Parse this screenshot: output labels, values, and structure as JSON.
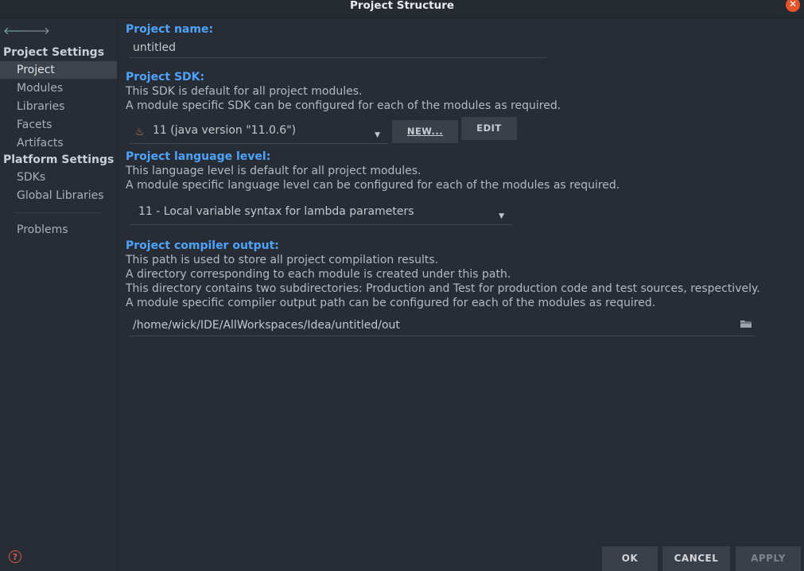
{
  "window": {
    "title": "Project Structure"
  },
  "sidebar": {
    "project_settings_label": "Project Settings",
    "project_items": [
      {
        "label": "Project",
        "selected": true
      },
      {
        "label": "Modules"
      },
      {
        "label": "Libraries"
      },
      {
        "label": "Facets"
      },
      {
        "label": "Artifacts"
      }
    ],
    "platform_settings_label": "Platform Settings",
    "platform_items": [
      {
        "label": "SDKs"
      },
      {
        "label": "Global Libraries"
      }
    ],
    "problems_label": "Problems"
  },
  "main": {
    "project_name": {
      "heading": "Project name:",
      "value": "untitled"
    },
    "project_sdk": {
      "heading": "Project SDK:",
      "line1": "This SDK is default for all project modules.",
      "line2": "A module specific SDK can be configured for each of the modules as required.",
      "selected": "11 (java version \"11.0.6\")",
      "new_button": "NEW...",
      "edit_button": "EDIT"
    },
    "language_level": {
      "heading": "Project language level:",
      "line1": "This language level is default for all project modules.",
      "line2": "A module specific language level can be configured for each of the modules as required.",
      "selected": "11 - Local variable syntax for lambda parameters"
    },
    "compiler_output": {
      "heading": "Project compiler output:",
      "line1": "This path is used to store all project compilation results.",
      "line2": "A directory corresponding to each module is created under this path.",
      "line3": "This directory contains two subdirectories: Production and Test for production code and test sources, respectively.",
      "line4": "A module specific compiler output path can be configured for each of the modules as required.",
      "path": "/home/wick/IDE/AllWorkspaces/Idea/untitled/out"
    }
  },
  "footer": {
    "ok": "OK",
    "cancel": "CANCEL",
    "apply": "APPLY"
  },
  "colors": {
    "background": "#282c34",
    "heading": "#4ea3ff",
    "close": "#e5532a"
  }
}
